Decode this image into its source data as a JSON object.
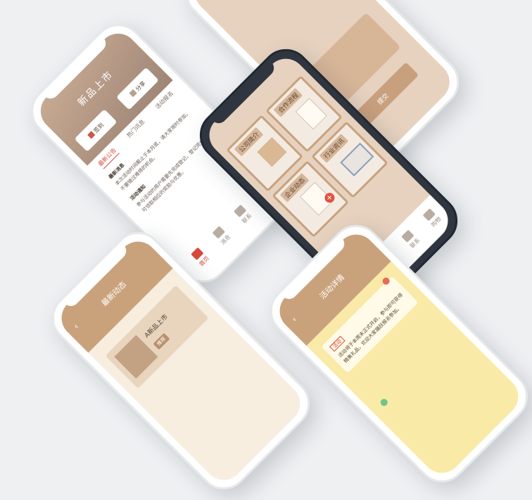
{
  "tabs": [
    "首页",
    "消息",
    "联系",
    "购物"
  ],
  "phoneA": {
    "header_title": "新品上市",
    "header_btn_left": "签到",
    "header_btn_right": "分享",
    "subtabs": [
      "最新公告",
      "热门讯息",
      "活动报名"
    ],
    "section1_title": "最新消息",
    "section1_body": "本次活动时间截止于本月底，请大家按时参加，不要错过难得的机会。",
    "section2_title": "活动通知",
    "section2_body": "参与活动的用户需要先完成登记，登记完成后即可领取相应的奖励与优惠。"
  },
  "phoneB": {
    "cards": [
      "公司简介",
      "合作流程",
      "企业动态",
      "行业资讯"
    ]
  },
  "phoneC": {
    "title": "最新动态",
    "item_title": "A新品上市",
    "tag": "推荐"
  },
  "phoneD": {
    "title": "活动详情",
    "highlight": "活动",
    "body": "活动将于本周末正式开启，参与即可获得精美礼品，欢迎大家踊跃报名参加。"
  },
  "phoneTop": {
    "btn": "提交"
  },
  "colors": {
    "accent": "#d64a3a",
    "tan": "#d7b698",
    "beige": "#e7d2bf",
    "yellow": "#f9eaa8"
  }
}
